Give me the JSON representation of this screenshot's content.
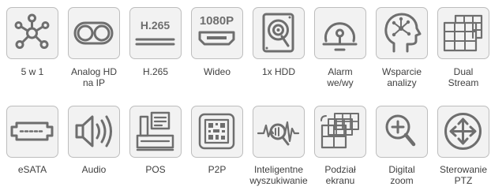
{
  "features": [
    {
      "icon": "network-hub-icon",
      "label": "5 w 1"
    },
    {
      "icon": "toggle-switch-icon",
      "label": "Analog HD\nna IP"
    },
    {
      "icon": "h265-codec-icon",
      "label": "H.265",
      "icon_text": "H.265"
    },
    {
      "icon": "hdmi-port-icon",
      "label": "Wideo",
      "icon_text": "1080P"
    },
    {
      "icon": "hard-disk-icon",
      "label": "1x HDD"
    },
    {
      "icon": "alarm-bell-icon",
      "label": "Alarm\nwe/wy"
    },
    {
      "icon": "analytics-head-icon",
      "label": "Wsparcie\nanalizy"
    },
    {
      "icon": "dual-stream-grid-icon",
      "label": "Dual\nStream"
    },
    {
      "icon": "esata-port-icon",
      "label": "eSATA"
    },
    {
      "icon": "speaker-icon",
      "label": "Audio"
    },
    {
      "icon": "pos-terminal-icon",
      "label": "POS"
    },
    {
      "icon": "qr-code-icon",
      "label": "P2P"
    },
    {
      "icon": "smart-search-icon",
      "label": "Inteligentne\nwyszukiwanie"
    },
    {
      "icon": "split-screen-icon",
      "label": "Podział\nekranu"
    },
    {
      "icon": "zoom-in-icon",
      "label": "Digital\nzoom"
    },
    {
      "icon": "ptz-arrows-icon",
      "label": "Sterowanie\nPTZ"
    }
  ],
  "colors": {
    "tile_background": "#f2f2f2",
    "tile_border": "#bdbdbd",
    "icon": "#6e6e6e",
    "label_text": "#3f3f3f"
  }
}
